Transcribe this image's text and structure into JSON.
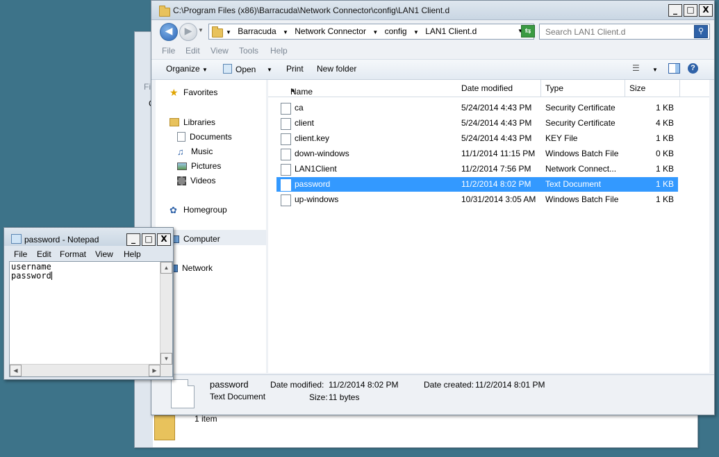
{
  "explorer": {
    "title": "C:\\Program Files (x86)\\Barracuda\\Network Connector\\config\\LAN1 Client.d",
    "window_buttons": {
      "minimize": "_",
      "maximize": "□",
      "close": "X"
    },
    "breadcrumb": [
      "Barracuda",
      "Network Connector",
      "config",
      "LAN1 Client.d"
    ],
    "search_placeholder": "Search LAN1 Client.d",
    "menu": [
      "File",
      "Edit",
      "View",
      "Tools",
      "Help"
    ],
    "toolbar": {
      "organize": "Organize",
      "open": "Open",
      "print": "Print",
      "new_folder": "New folder"
    },
    "nav": {
      "favorites": "Favorites",
      "libraries": "Libraries",
      "library_items": [
        "Documents",
        "Music",
        "Pictures",
        "Videos"
      ],
      "homegroup": "Homegroup",
      "computer": "Computer",
      "network": "Network"
    },
    "columns": {
      "name": "Name",
      "date": "Date modified",
      "type": "Type",
      "size": "Size"
    },
    "files": [
      {
        "name": "ca",
        "date": "5/24/2014 4:43 PM",
        "type": "Security Certificate",
        "size": "1 KB",
        "icon": "certificate-icon"
      },
      {
        "name": "client",
        "date": "5/24/2014 4:43 PM",
        "type": "Security Certificate",
        "size": "4 KB",
        "icon": "certificate-icon"
      },
      {
        "name": "client.key",
        "date": "5/24/2014 4:43 PM",
        "type": "KEY File",
        "size": "1 KB",
        "icon": "file-icon"
      },
      {
        "name": "down-windows",
        "date": "11/1/2014 11:15 PM",
        "type": "Windows Batch File",
        "size": "0 KB",
        "icon": "batch-file-icon"
      },
      {
        "name": "LAN1Client",
        "date": "11/2/2014 7:56 PM",
        "type": "Network Connect...",
        "size": "1 KB",
        "icon": "network-connector-icon"
      },
      {
        "name": "password",
        "date": "11/2/2014 8:02 PM",
        "type": "Text Document",
        "size": "1 KB",
        "icon": "text-file-icon",
        "selected": true
      },
      {
        "name": "up-windows",
        "date": "10/31/2014 3:05 AM",
        "type": "Windows Batch File",
        "size": "1 KB",
        "icon": "batch-file-icon"
      }
    ],
    "details": {
      "name": "password",
      "type": "Text Document",
      "modified_label": "Date modified:",
      "modified": "11/2/2014 8:02 PM",
      "created_label": "Date created:",
      "created": "11/2/2014 8:01 PM",
      "size_label": "Size:",
      "size": "11 bytes"
    }
  },
  "background_window": {
    "menu_stub": "Fi",
    "letter_stub": "C",
    "status": "1 item"
  },
  "notepad": {
    "title": "password - Notepad",
    "menu": [
      "File",
      "Edit",
      "Format",
      "View",
      "Help"
    ],
    "lines": [
      "username",
      "password"
    ]
  },
  "colors": {
    "desktop": "#3d7389",
    "selection": "#3399ff"
  }
}
